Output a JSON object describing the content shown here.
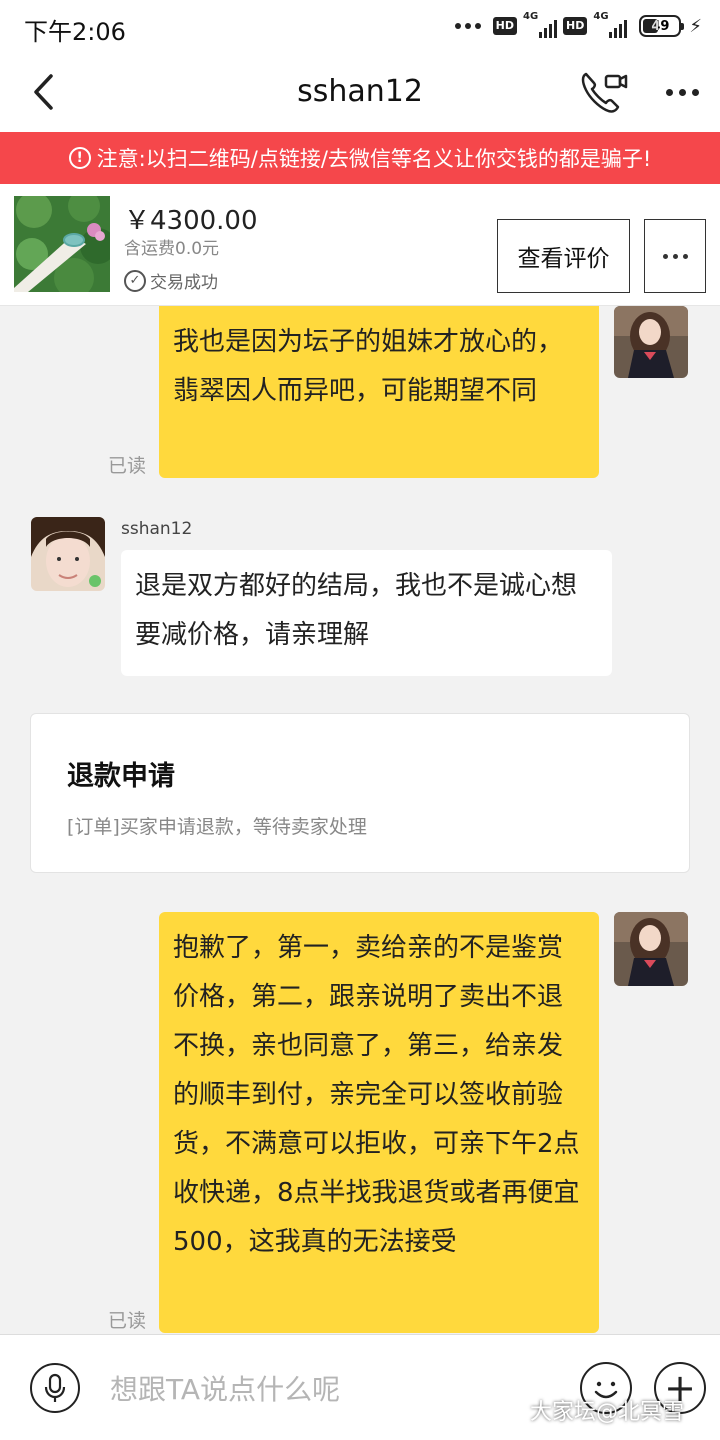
{
  "status_bar": {
    "time": "下午2:06",
    "hd1": "HD",
    "net1": "4G",
    "hd2": "HD",
    "net2": "4G",
    "battery": "49",
    "battery_level": 0.49
  },
  "header": {
    "title": "sshan12",
    "back_icon": "chevron-left-icon",
    "call_icon": "video-call-icon",
    "more_icon": "more-horizontal-icon"
  },
  "warning": {
    "icon": "!",
    "text": "注意:以扫二维码/点链接/去微信等名义让你交钱的都是骗子!"
  },
  "product": {
    "price": "￥4300.00",
    "shipping": "含运费0.0元",
    "status": "交易成功",
    "status_icon": "✓",
    "review_button": "查看评价"
  },
  "messages": {
    "m1": {
      "text": "我也是因为坛子的姐妹才放心的，翡翠因人而异吧，可能期望不同",
      "read": "已读"
    },
    "m2": {
      "sender": "sshan12",
      "text": "退是双方都好的结局，我也不是诚心想要减价格，请亲理解"
    },
    "refund": {
      "title": "退款申请",
      "desc": "[订单]买家申请退款，等待卖家处理"
    },
    "m3": {
      "text": "抱歉了，第一，卖给亲的不是鉴赏价格，第二，跟亲说明了卖出不退不换，亲也同意了，第三，给亲发的顺丰到付，亲完全可以签收前验货，不满意可以拒收，可亲下午2点收快递，8点半找我退货或者再便宜500，这我真的无法接受",
      "read": "已读"
    }
  },
  "input": {
    "placeholder": "想跟TA说点什么呢",
    "plus": "+"
  },
  "watermark": "大家坛@北冥雪",
  "colors": {
    "warning_bg": "#f5474b",
    "my_bubble": "#ffd93d",
    "their_bubble": "#ffffff",
    "chat_bg": "#f2f2f2"
  }
}
